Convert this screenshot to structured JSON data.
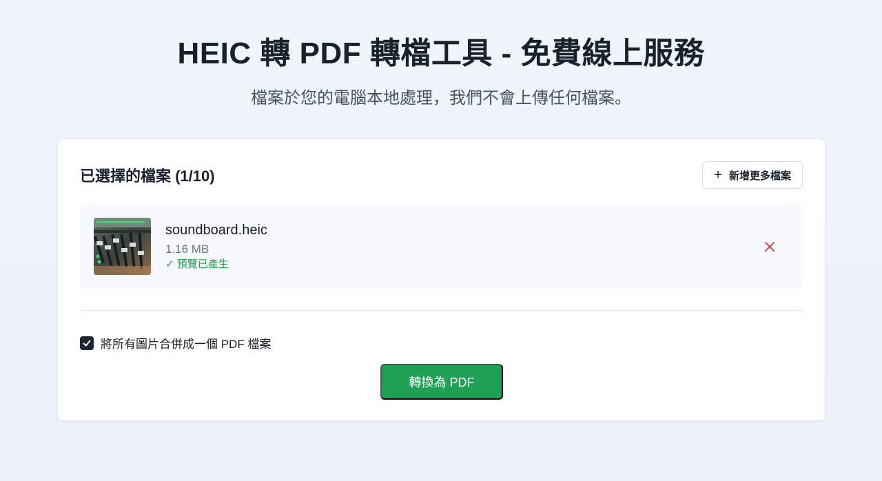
{
  "hero": {
    "title": "HEIC 轉 PDF 轉檔工具 - 免費線上服務",
    "subtitle": "檔案於您的電腦本地處理，我們不會上傳任何檔案。"
  },
  "card": {
    "title": "已選擇的檔案 (1/10)",
    "add_more_label": "新增更多檔案",
    "files": [
      {
        "name": "soundboard.heic",
        "size": "1.16 MB",
        "status": "✓ 預覽已產生"
      }
    ],
    "merge_label": "將所有圖片合併成一個 PDF 檔案",
    "merge_checked": true,
    "convert_label": "轉換為 PDF"
  },
  "icons": {
    "add": "plus-icon",
    "remove": "close-icon",
    "check": "check-icon"
  },
  "colors": {
    "accent_green": "#1fa155",
    "status_green": "#1f9d4f",
    "remove_red": "#d94b4b",
    "checkbox_dark": "#1f2433"
  }
}
